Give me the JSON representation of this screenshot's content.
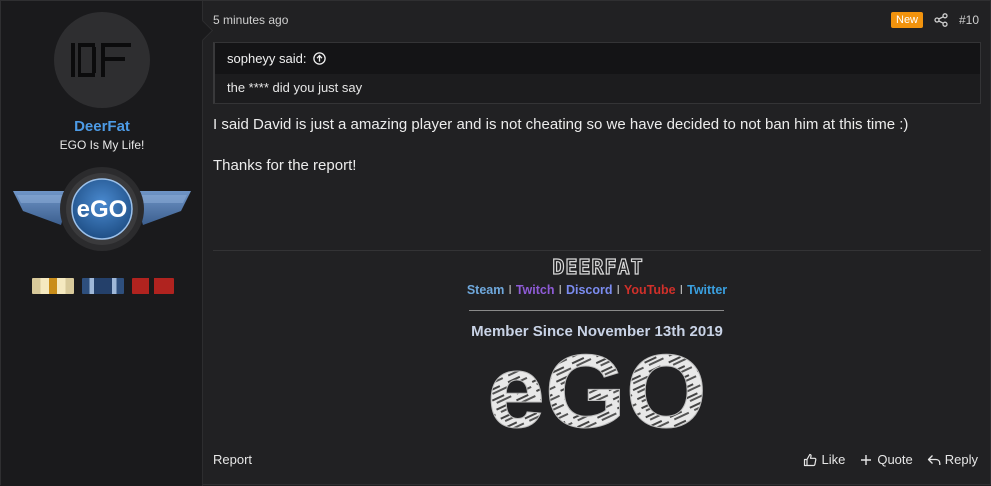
{
  "user": {
    "avatar_text": "DF",
    "name": "DeerFat",
    "title": "EGO Is My Life!",
    "banner_text": "eGO"
  },
  "post": {
    "time": "5 minutes ago",
    "new_label": "New",
    "number": "#10",
    "quote_author": "sopheyy said:",
    "quote_text": "the **** did you just say",
    "message": [
      "I said David is just a amazing player and is not cheating so we have decided to not ban him at this time :)",
      "Thanks for the report!"
    ]
  },
  "signature": {
    "logo_text": "DEERFAT",
    "links": [
      {
        "label": "Steam",
        "color": "#6fa8dc"
      },
      {
        "label": "Twitch",
        "color": "#8e5bd6"
      },
      {
        "label": "Discord",
        "color": "#7b8cf0"
      },
      {
        "label": "YouTube",
        "color": "#d0302a"
      },
      {
        "label": "Twitter",
        "color": "#3aa0e0"
      }
    ],
    "separator": "I",
    "member_since": "Member Since November 13th 2019",
    "ego_text": "eGO"
  },
  "footer": {
    "report": "Report",
    "like": "Like",
    "quote": "Quote",
    "reply": "Reply"
  }
}
